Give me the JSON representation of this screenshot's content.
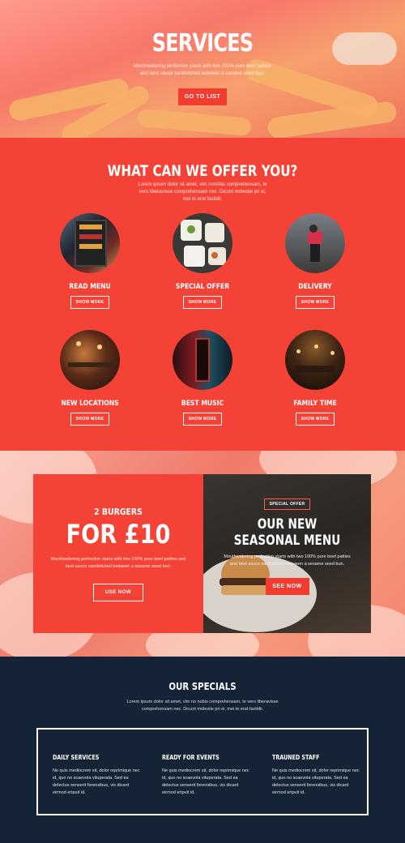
{
  "hero": {
    "title": "SERVICES",
    "subtitle": "Mouthwatering perfection starts with two 100% pure beef patties and best sauce sandwiched between a sesame seed bun.",
    "button": "GO TO LIST"
  },
  "offer": {
    "title": "WHAT CAN WE OFFER YOU?",
    "subtitle": "Lorem ipsum dolor sit amet, vim nonobis comprehensam, te vero liberavisse comprehensam nec. Dicunt molestie pri ei, mei te erat fastidii.",
    "items": [
      {
        "label": "READ MENU",
        "button": "SHOW MORE",
        "icon": "menu-board-image"
      },
      {
        "label": "SPECIAL OFFER",
        "button": "SHOW MORE",
        "icon": "plates-image"
      },
      {
        "label": "DELIVERY",
        "button": "SHOW MORE",
        "icon": "delivery-rider-image"
      },
      {
        "label": "NEW LOCATIONS",
        "button": "SHOW MORE",
        "icon": "restaurant-interior-image"
      },
      {
        "label": "BEST MUSIC",
        "button": "SHOW MORE",
        "icon": "music-venue-image"
      },
      {
        "label": "FAMILY TIME",
        "button": "SHOW MORE",
        "icon": "dining-room-image"
      }
    ]
  },
  "promo": {
    "left": {
      "small_title": "2 BURGERS",
      "big_title": "FOR £10",
      "desc": "Mouthwatering perfection starts with two 100% pure beef patties and best sauce sandwiched between a sesame seed bun.",
      "button": "USE NOW"
    },
    "right": {
      "tag": "SPECIAL OFFER",
      "headline_1": "OUR NEW",
      "headline_2": "SEASONAL MENU",
      "desc": "Mouthwatering perfection starts with two 100% pure beef patties and best sauce sandwiched between a sesame seed bun.",
      "button": "SEE NOW"
    }
  },
  "specials": {
    "title": "OUR SPECIALS",
    "subtitle": "Lorem ipsum dolor sit amet, vim no nobis comprehensam, te vero liberavisse comprehensam nec. Dicunt molestie pri ei, mei te erat fastidii.",
    "columns": [
      {
        "title": "DAILY SERVICES",
        "text": "Ne quis mediocrem sit, dolor reprimique nec id, quo no scaevola vituperata. Sed ea delectus senserit forensibus, vis dicant eirmod eripuit id."
      },
      {
        "title": "READY FOR EVENTS",
        "text": "Ne quis mediocrem sit, dolor reprimique nec id, quo no scaevola vituperata. Sed ea delectus senserit forensibus, vis dicant eirmod eripuit id."
      },
      {
        "title": "TRAUNED STAFF",
        "text": "Ne quis mediocrem sit, dolor reprimique nec id, quo no scaevola vituperata. Sed ea delectus senserit forensibus, vis dicant eirmod eripuit id."
      }
    ]
  },
  "colors": {
    "accent": "#f44336",
    "dark": "#152336",
    "button": "#f13c2f"
  }
}
